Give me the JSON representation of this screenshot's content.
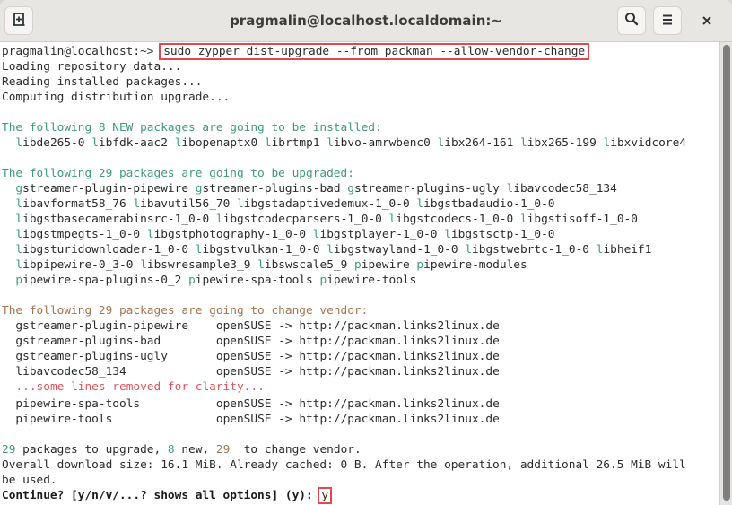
{
  "window": {
    "title": "pragmalin@localhost.localdomain:~",
    "buttons": {
      "new_tab_icon": "new-tab-icon",
      "search_icon": "search-icon",
      "menu_icon": "hamburger-menu-icon",
      "close_icon": "close-icon",
      "close_glyph": "×"
    }
  },
  "colors": {
    "green": "#3e9a7c",
    "brown": "#a5734f",
    "red": "#e0545c",
    "highlight_box": "#e5474f"
  },
  "terminal": {
    "prompt": "pragmalin@localhost:~> ",
    "command": "sudo zypper dist-upgrade --from packman --allow-vendor-change",
    "status_lines": [
      "Loading repository data...",
      "Reading installed packages...",
      "Computing distribution upgrade..."
    ],
    "new_header": "The following 8 NEW packages are going to be installed:",
    "new_packages": [
      [
        "libde265-0",
        "libfdk-aac2",
        "libopenaptx0",
        "librtmp1",
        "libvo-amrwbenc0",
        "libx264-161",
        "libx265-199",
        "libxvidcore4"
      ]
    ],
    "upgrade_header": "The following 29 packages are going to be upgraded:",
    "upgrade_packages": [
      [
        "gstreamer-plugin-pipewire",
        "gstreamer-plugins-bad",
        "gstreamer-plugins-ugly",
        "libavcodec58_134"
      ],
      [
        "libavformat58_76",
        "libavutil56_70",
        "libgstadaptivedemux-1_0-0",
        "libgstbadaudio-1_0-0"
      ],
      [
        "libgstbasecamerabinsrc-1_0-0",
        "libgstcodecparsers-1_0-0",
        "libgstcodecs-1_0-0",
        "libgstisoff-1_0-0"
      ],
      [
        "libgstmpegts-1_0-0",
        "libgstphotography-1_0-0",
        "libgstplayer-1_0-0",
        "libgstsctp-1_0-0"
      ],
      [
        "libgsturidownloader-1_0-0",
        "libgstvulkan-1_0-0",
        "libgstwayland-1_0-0",
        "libgstwebrtc-1_0-0",
        "libheif1"
      ],
      [
        "libpipewire-0_3-0",
        "libswresample3_9",
        "libswscale5_9",
        "pipewire",
        "pipewire-modules"
      ],
      [
        "pipewire-spa-plugins-0_2",
        "pipewire-spa-tools",
        "pipewire-tools"
      ]
    ],
    "vendor_header": "The following 29 packages are going to change vendor:",
    "vendor_rows": [
      {
        "pkg": "gstreamer-plugin-pipewire",
        "from": "openSUSE",
        "arrow": "->",
        "to": "http://packman.links2linux.de"
      },
      {
        "pkg": "gstreamer-plugins-bad",
        "from": "openSUSE",
        "arrow": "->",
        "to": "http://packman.links2linux.de"
      },
      {
        "pkg": "gstreamer-plugins-ugly",
        "from": "openSUSE",
        "arrow": "->",
        "to": "http://packman.links2linux.de"
      },
      {
        "pkg": "libavcodec58_134",
        "from": "openSUSE",
        "arrow": "->",
        "to": "http://packman.links2linux.de"
      }
    ],
    "removed_note": "...some lines removed for clarity...",
    "vendor_rows_tail": [
      {
        "pkg": "pipewire-spa-tools",
        "from": "openSUSE",
        "arrow": "->",
        "to": "http://packman.links2linux.de"
      },
      {
        "pkg": "pipewire-tools",
        "from": "openSUSE",
        "arrow": "->",
        "to": "http://packman.links2linux.de"
      }
    ],
    "summary": {
      "upgrade_count": "29",
      "upgrade_text": " packages to upgrade, ",
      "new_count": "8",
      "new_text": " new, ",
      "vendor_count": "29",
      "vendor_text": "  to change vendor."
    },
    "download_line_1": "Overall download size: 16.1 MiB. Already cached: 0 B. After the operation, additional 26.5 MiB will",
    "download_line_2": "be used.",
    "continue_prompt": "Continue? [y/n/v/...? shows all options] (y): ",
    "answer": "y"
  }
}
